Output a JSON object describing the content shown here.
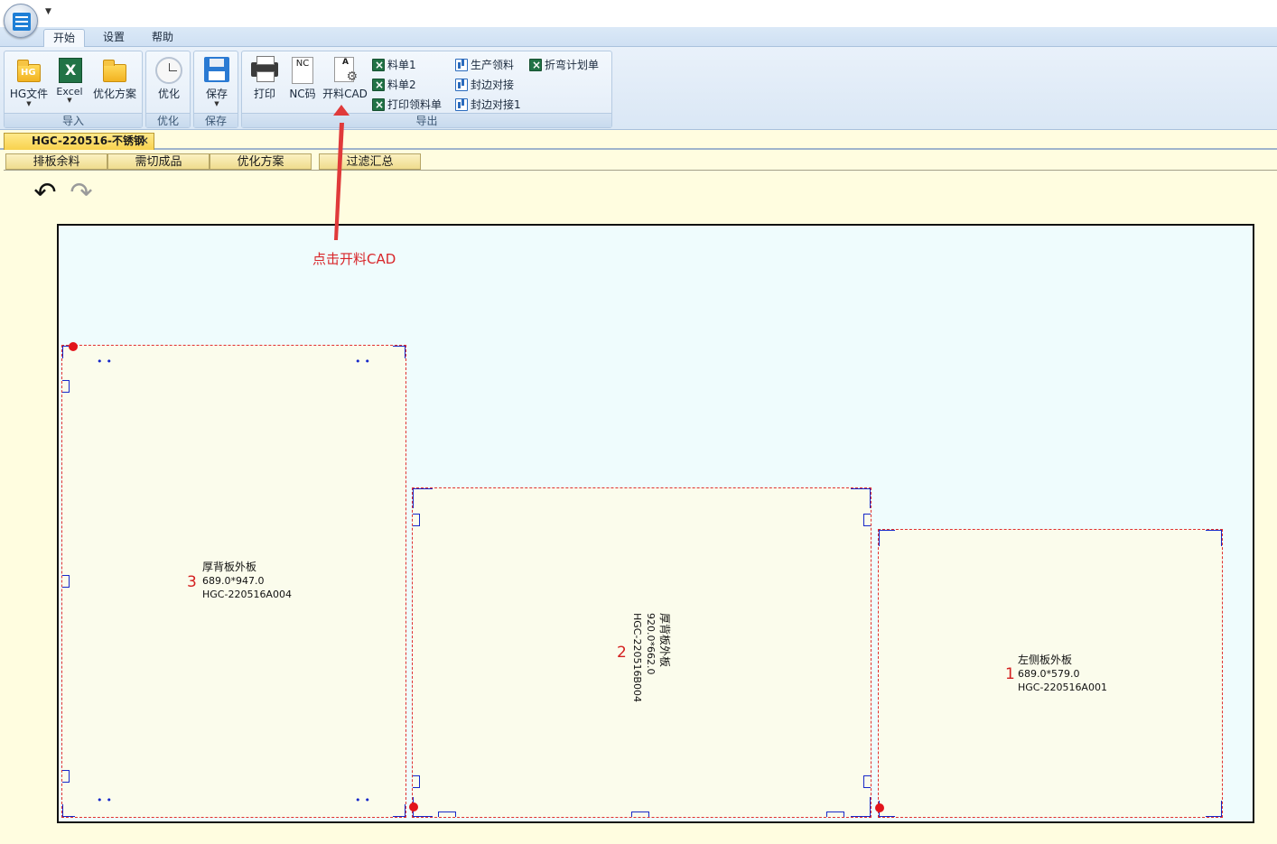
{
  "ribbon": {
    "tabs": [
      {
        "label": "开始",
        "active": true
      },
      {
        "label": "设置",
        "active": false
      },
      {
        "label": "帮助",
        "active": false
      }
    ],
    "groups": {
      "import": {
        "label": "导入",
        "buttons": {
          "hg_file": {
            "label": "HG文件",
            "icon_text": "HG"
          },
          "excel": {
            "label": "Excel",
            "icon_text": "X"
          },
          "opt_plan": {
            "label": "优化方案"
          }
        }
      },
      "optimize": {
        "label": "优化",
        "button": "优化"
      },
      "save": {
        "label": "保存",
        "button": "保存"
      },
      "export": {
        "label": "导出",
        "print": "打印",
        "nc_code": "NC码",
        "nc_icon_text": "NC",
        "cut_cad": "开料CAD",
        "cad_icon_text": "A",
        "small_buttons": {
          "list1": "料单1",
          "list2": "料单2",
          "print_pick_list": "打印领料单",
          "prod_pick": "生产领料",
          "edge_join": "封边对接",
          "edge_join1": "封边对接1",
          "bend_plan": "折弯计划单"
        }
      }
    }
  },
  "document": {
    "tab_title": "HGC-220516-不锈钢",
    "subtabs": [
      "排板余料",
      "需切成品",
      "优化方案",
      "过滤汇总"
    ]
  },
  "parts": [
    {
      "num": "3",
      "name": "厚背板外板",
      "size": "689.0*947.0",
      "code": "HGC-220516A004"
    },
    {
      "num": "2",
      "name": "厚背板外板",
      "size": "920.0*662.0",
      "code": "HGC-220516B004"
    },
    {
      "num": "1",
      "name": "左侧板外板",
      "size": "689.0*579.0",
      "code": "HGC-220516A001"
    }
  ],
  "annotation": {
    "text": "点击开料CAD",
    "color": "#d8262a"
  },
  "colors": {
    "ribbon": "#dae7f5",
    "sheet_bg": "#effcfd",
    "part_bg": "#fbfcec",
    "cut_line": "#e03030",
    "feature_line": "#1728c9"
  }
}
